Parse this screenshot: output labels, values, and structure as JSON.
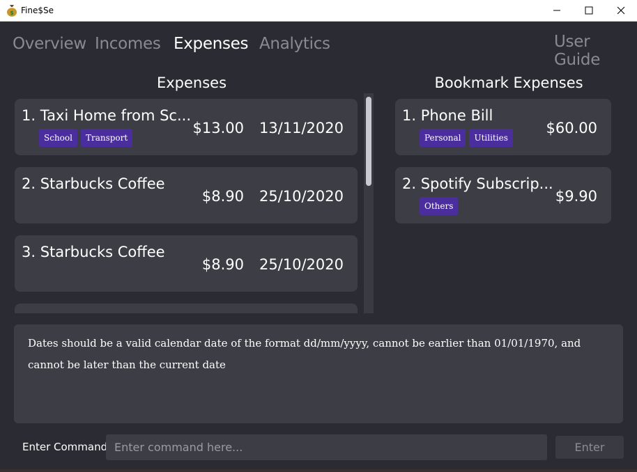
{
  "window": {
    "title": "Fine$Se",
    "icon": "money-bag-icon"
  },
  "nav": {
    "tabs": [
      {
        "label": "Overview",
        "active": false
      },
      {
        "label": "Incomes",
        "active": false
      },
      {
        "label": "Expenses",
        "active": true
      },
      {
        "label": "Analytics",
        "active": false
      }
    ],
    "user_guide": "User Guide"
  },
  "expenses": {
    "title": "Expenses",
    "items": [
      {
        "name": "1. Taxi Home from Sc...",
        "amount": "$13.00",
        "date": "13/11/2020",
        "tags": [
          "School",
          "Transport"
        ]
      },
      {
        "name": "2. Starbucks Coffee",
        "amount": "$8.90",
        "date": "25/10/2020",
        "tags": []
      },
      {
        "name": "3. Starbucks Coffee",
        "amount": "$8.90",
        "date": "25/10/2020",
        "tags": []
      }
    ]
  },
  "bookmarks": {
    "title": "Bookmark Expenses",
    "items": [
      {
        "name": "1. Phone Bill",
        "amount": "$60.00",
        "tags": [
          "Personal",
          "Utilities"
        ]
      },
      {
        "name": "2. Spotify Subscrip...",
        "amount": "$9.90",
        "tags": [
          "Others"
        ]
      }
    ]
  },
  "result": {
    "message": "Dates should be a valid calendar date of the format dd/mm/yyyy, cannot be earlier than 01/01/1970, and cannot be later than the current date"
  },
  "command": {
    "label": "Enter Command:",
    "placeholder": "Enter command here...",
    "value": "",
    "enter_label": "Enter"
  },
  "colors": {
    "background": "#2b2b33",
    "card": "#3d3d45",
    "tag": "#4b2e9e",
    "tab_inactive": "#8a8a92"
  }
}
